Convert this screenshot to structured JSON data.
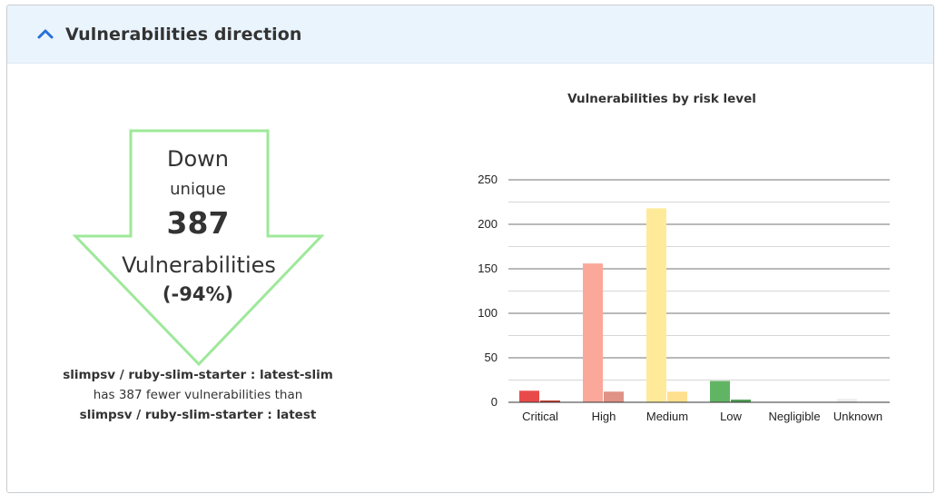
{
  "panel": {
    "title": "Vulnerabilities direction",
    "collapse_icon": "chevron-up-icon",
    "accent_color": "#2670d8"
  },
  "direction": {
    "label": "Down",
    "sublabel": "unique",
    "count": "387",
    "unit": "Vulnerabilities",
    "percent": "(-94%)",
    "arrow_color": "#9ee89a"
  },
  "comparison": {
    "target": "slimpsv / ruby-slim-starter : latest-slim",
    "text": "has 387 fewer vulnerabilities than",
    "baseline": "slimpsv / ruby-slim-starter : latest"
  },
  "chart_data": {
    "type": "bar",
    "title": "Vulnerabilities by risk level",
    "categories": [
      "Critical",
      "High",
      "Medium",
      "Low",
      "Negligible",
      "Unknown"
    ],
    "ylim": [
      0,
      250
    ],
    "yticks": [
      0,
      50,
      100,
      150,
      200,
      250
    ],
    "grid": true,
    "series": [
      {
        "values": [
          13,
          156,
          218,
          24,
          0,
          4
        ],
        "colors": [
          "#e84a4a",
          "#fba89b",
          "#ffea99",
          "#62b465",
          "#cccccc",
          "#eeeeee"
        ]
      },
      {
        "values": [
          2,
          12,
          12,
          3,
          0,
          0
        ],
        "colors": [
          "#c0392b",
          "#e09286",
          "#ffe08f",
          "#4f9e53",
          "#bbbbbb",
          "#dddddd"
        ]
      }
    ]
  }
}
